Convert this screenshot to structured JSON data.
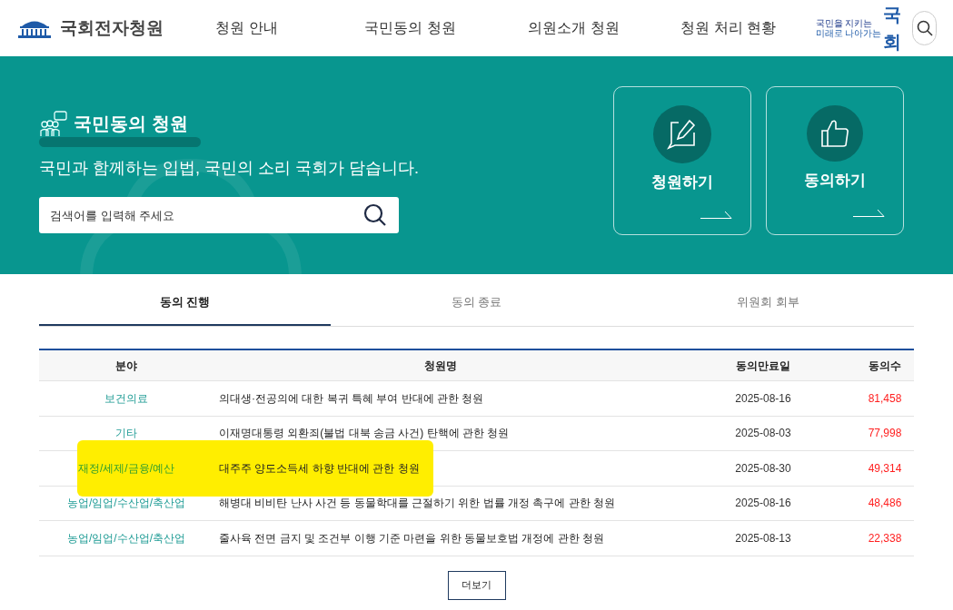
{
  "header": {
    "site_title": "국회전자청원",
    "nav": [
      {
        "label": "청원 안내",
        "selected": false
      },
      {
        "label": "국민동의 청원",
        "selected": false
      },
      {
        "label": "의원소개 청원",
        "selected": false
      },
      {
        "label": "청원 처리 현황",
        "selected": false
      }
    ],
    "slogan": {
      "line_1": "국민을 지키는",
      "line_2": "미래로 나아가는",
      "mark": "국회"
    }
  },
  "banner": {
    "title": "국민동의 청원",
    "subtitle": "국민과 함께하는 입법, 국민의 소리 국회가 담습니다.",
    "search": {
      "placeholder": "검색어를 입력해 주세요"
    },
    "cards": [
      {
        "kind": "write",
        "label": "청원하기"
      },
      {
        "kind": "agree",
        "label": "동의하기"
      }
    ]
  },
  "tabs": [
    {
      "label": "동의 진행",
      "selected": true
    },
    {
      "label": "동의 종료",
      "selected": false
    },
    {
      "label": "위원회 회부",
      "selected": false
    }
  ],
  "table": {
    "columns": [
      "분야",
      "청원명",
      "동의만료일",
      "동의수"
    ],
    "rows": [
      {
        "field": "보건의료",
        "title": "의대생·전공의에 대한 복귀 특혜 부여 반대에 관한 청원",
        "deadline": "2025-08-16",
        "count": "81,458",
        "highlighted": false
      },
      {
        "field": "기타",
        "title": "이재명대통령 외환죄(불법 대북 송금 사건) 탄핵에 관한 청원",
        "deadline": "2025-08-03",
        "count": "77,998",
        "highlighted": false
      },
      {
        "field": "재정/세제/금융/예산",
        "title": "대주주 양도소득세 하향 반대에 관한 청원",
        "deadline": "2025-08-30",
        "count": "49,314",
        "highlighted": true
      },
      {
        "field": "농업/임업/수산업/축산업",
        "title": "해병대 비비탄 난사 사건 등 동물학대를 근절하기 위한 법률 개정 촉구에 관한 청원",
        "deadline": "2025-08-16",
        "count": "48,486",
        "highlighted": false
      },
      {
        "field": "농업/임업/수산업/축산업",
        "title": "줄사육 전면 금지 및 조건부 이행 기준 마련을 위한 동물보호법 개정에 관한 청원",
        "deadline": "2025-08-13",
        "count": "22,338",
        "highlighted": false
      }
    ]
  },
  "more_button": "더보기"
}
